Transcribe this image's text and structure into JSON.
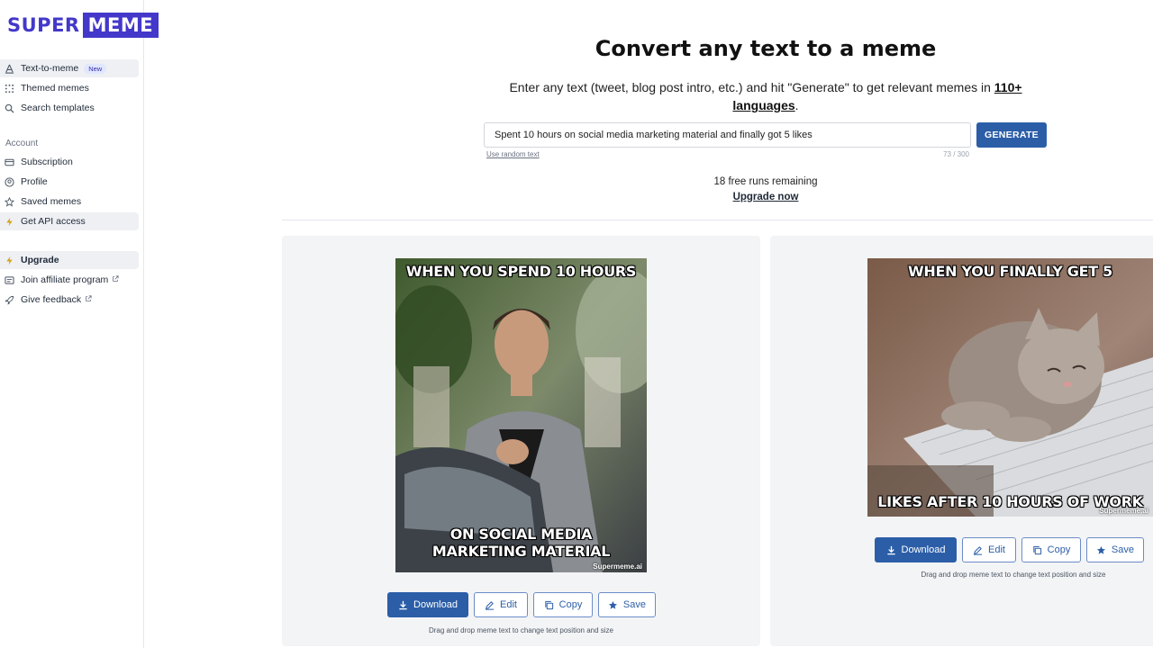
{
  "brand": {
    "part1": "SUPER",
    "part2": "MEME"
  },
  "sidebar": {
    "primary": [
      {
        "label": "Text-to-meme",
        "badge": "New",
        "icon": "text-icon"
      },
      {
        "label": "Themed memes",
        "icon": "grid-icon"
      },
      {
        "label": "Search templates",
        "icon": "search-icon"
      }
    ],
    "account_label": "Account",
    "account": [
      {
        "label": "Subscription",
        "icon": "card-icon"
      },
      {
        "label": "Profile",
        "icon": "user-icon"
      },
      {
        "label": "Saved memes",
        "icon": "star-icon"
      },
      {
        "label": "Get API access",
        "icon": "bolt-icon"
      }
    ],
    "extras": [
      {
        "label": "Upgrade",
        "icon": "bolt-icon"
      },
      {
        "label": "Join affiliate program",
        "icon": "affiliate-icon"
      },
      {
        "label": "Give feedback",
        "icon": "rocket-icon"
      }
    ]
  },
  "main": {
    "title": "Convert any text to a meme",
    "subtitle_text": "Enter any text (tweet, blog post intro, etc.) and hit \"Generate\" to get relevant memes in",
    "subtitle_link": "110+ languages",
    "subtitle_end": ".",
    "input_value": "Spent 10 hours on social media marketing material and finally got 5 likes",
    "generate_label": "GENERATE",
    "random_text_label": "Use random text",
    "char_counter": "73 / 300",
    "runs_remaining": "18 free runs remaining",
    "upgrade_now": "Upgrade now"
  },
  "memes": [
    {
      "top_text": "WHEN YOU SPEND 10 HOURS",
      "bottom_text": "ON SOCIAL MEDIA MARKETING MATERIAL",
      "watermark": "Supermeme.ai",
      "download": "Download",
      "edit": "Edit",
      "copy": "Copy",
      "save": "Save",
      "hint": "Drag and drop meme text to change text position and size"
    },
    {
      "top_text": "WHEN YOU FINALLY GET 5",
      "bottom_text": "LIKES AFTER 10 HOURS OF WORK",
      "watermark": "Supermeme.ai",
      "download": "Download",
      "edit": "Edit",
      "copy": "Copy",
      "save": "Save",
      "hint": "Drag and drop meme text to change text position and size"
    }
  ],
  "colors": {
    "brand": "#4338ca",
    "primary": "#2c5ea8",
    "card_bg": "#f3f4f6"
  }
}
